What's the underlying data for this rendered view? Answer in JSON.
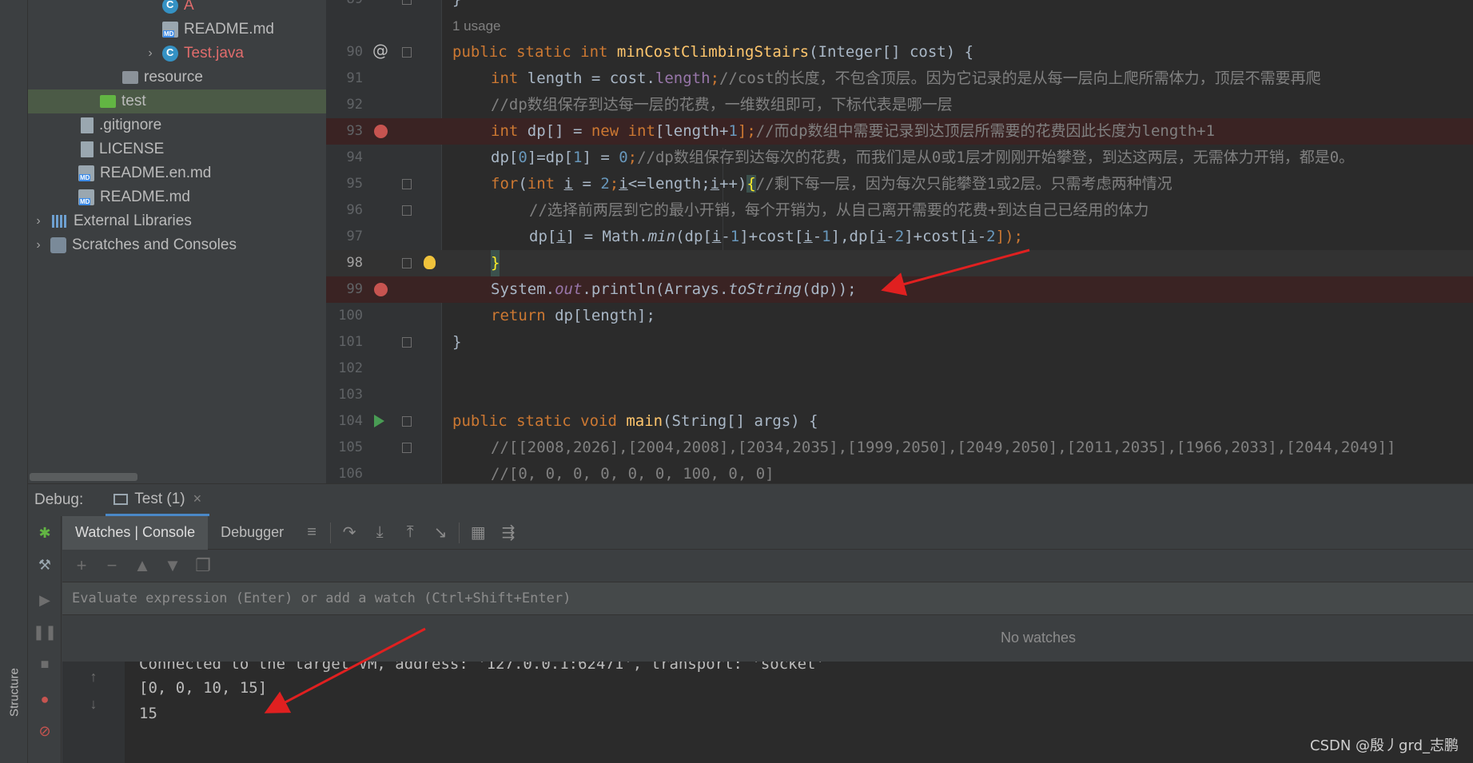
{
  "sidebar": {
    "structure_tab": "Structure"
  },
  "project_tree": {
    "items": [
      {
        "label": "A",
        "icon": "java-class-icon",
        "color": "#e06c6c"
      },
      {
        "label": "README.md",
        "icon": "markdown-file-icon",
        "color": "#bbbbbb"
      },
      {
        "label": "Test.java",
        "icon": "java-class-icon",
        "color": "#e06c6c",
        "expandable": true
      },
      {
        "label": "resource",
        "icon": "folder-icon",
        "color": "#bbbbbb"
      },
      {
        "label": "test",
        "icon": "test-folder-icon",
        "color": "#bbbbbb",
        "selected": true
      },
      {
        "label": ".gitignore",
        "icon": "file-icon",
        "color": "#bbbbbb"
      },
      {
        "label": "LICENSE",
        "icon": "file-icon",
        "color": "#bbbbbb"
      },
      {
        "label": "README.en.md",
        "icon": "markdown-file-icon",
        "color": "#bbbbbb"
      },
      {
        "label": "README.md",
        "icon": "markdown-file-icon",
        "color": "#bbbbbb"
      },
      {
        "label": "External Libraries",
        "icon": "library-icon",
        "color": "#bbbbbb",
        "expandable": true
      },
      {
        "label": "Scratches and Consoles",
        "icon": "scratches-icon",
        "color": "#bbbbbb",
        "expandable": true
      }
    ]
  },
  "editor": {
    "usage_hint": "1 usage",
    "line_numbers": [
      "89",
      "",
      "90",
      "91",
      "92",
      "93",
      "94",
      "95",
      "96",
      "97",
      "98",
      "99",
      "100",
      "101",
      "102",
      "103",
      "104",
      "105",
      "106"
    ],
    "lines": {
      "l89": "}",
      "l90": [
        "public static int ",
        "minCostClimbingStairs",
        "(Integer[] cost) {"
      ],
      "l91": [
        "int ",
        "length = cost.",
        "length",
        ";",
        "//cost的长度，不包含顶层。因为它记录的是从每一层向上爬所需体力，顶层不需要再爬"
      ],
      "l92": "//dp数组保存到达每一层的花费，一维数组即可，下标代表是哪一层",
      "l93": [
        "int ",
        "dp[] = ",
        "new int",
        "[length+",
        "1",
        "];",
        "//而dp数组中需要记录到达顶层所需要的花费因此长度为length+1"
      ],
      "l94": [
        "dp[",
        "0",
        "]=dp[",
        "1",
        "] = ",
        "0",
        ";",
        "//dp数组保存到达每次的花费，而我们是从0或1层才刚刚开始攀登，到达这两层，无需体力开销，都是0。"
      ],
      "l95": [
        "for",
        "(",
        "int ",
        "i",
        " = ",
        "2",
        ";",
        "i",
        "<=length;",
        "i",
        "++)",
        "{",
        "//剩下每一层，因为每次只能攀登1或2层。只需考虑两种情况"
      ],
      "l96": "//选择前两层到它的最小开销，每个开销为，从自己离开需要的花费+到达自己已经用的体力",
      "l97": [
        "dp[",
        "i",
        "] = Math.",
        "min",
        "(dp[",
        "i",
        "-",
        "1",
        "]+cost[",
        "i",
        "-",
        "1",
        "],dp[",
        "i",
        "-",
        "2",
        "]+cost[",
        "i",
        "-",
        "2",
        "]);"
      ],
      "l98": "}",
      "l99": [
        "System.",
        "out",
        ".println(Arrays.",
        "toString",
        "(dp));"
      ],
      "l100": [
        "return ",
        "dp[length];"
      ],
      "l101": "}",
      "l104": [
        "public static void ",
        "main",
        "(String[] args) {"
      ],
      "l105": "//[[2008,2026],[2004,2008],[2034,2035],[1999,2050],[2049,2050],[2011,2035],[1966,2033],[2044,2049]]",
      "l106": "//[0, 0, 0, 0, 0, 0, 100, 0, 0]"
    }
  },
  "debug": {
    "label": "Debug:",
    "tab_title": "Test (1)",
    "subtabs": [
      "Watches | Console",
      "Debugger"
    ],
    "eval_placeholder": "Evaluate expression (Enter) or add a watch (Ctrl+Shift+Enter)",
    "no_watches": "No watches",
    "console_lines": [
      "Connected to the target VM, address: '127.0.0.1:62471', transport: 'socket'",
      "[0, 0, 10, 15]",
      "15"
    ]
  },
  "watermark": "CSDN @殷丿grd_志鹏",
  "colors": {
    "keyword": "#cc7832",
    "function": "#ffc66d",
    "number": "#6897bb",
    "comment": "#808080",
    "breakpoint": "#c75450",
    "annotation_arrow": "#e02020"
  }
}
